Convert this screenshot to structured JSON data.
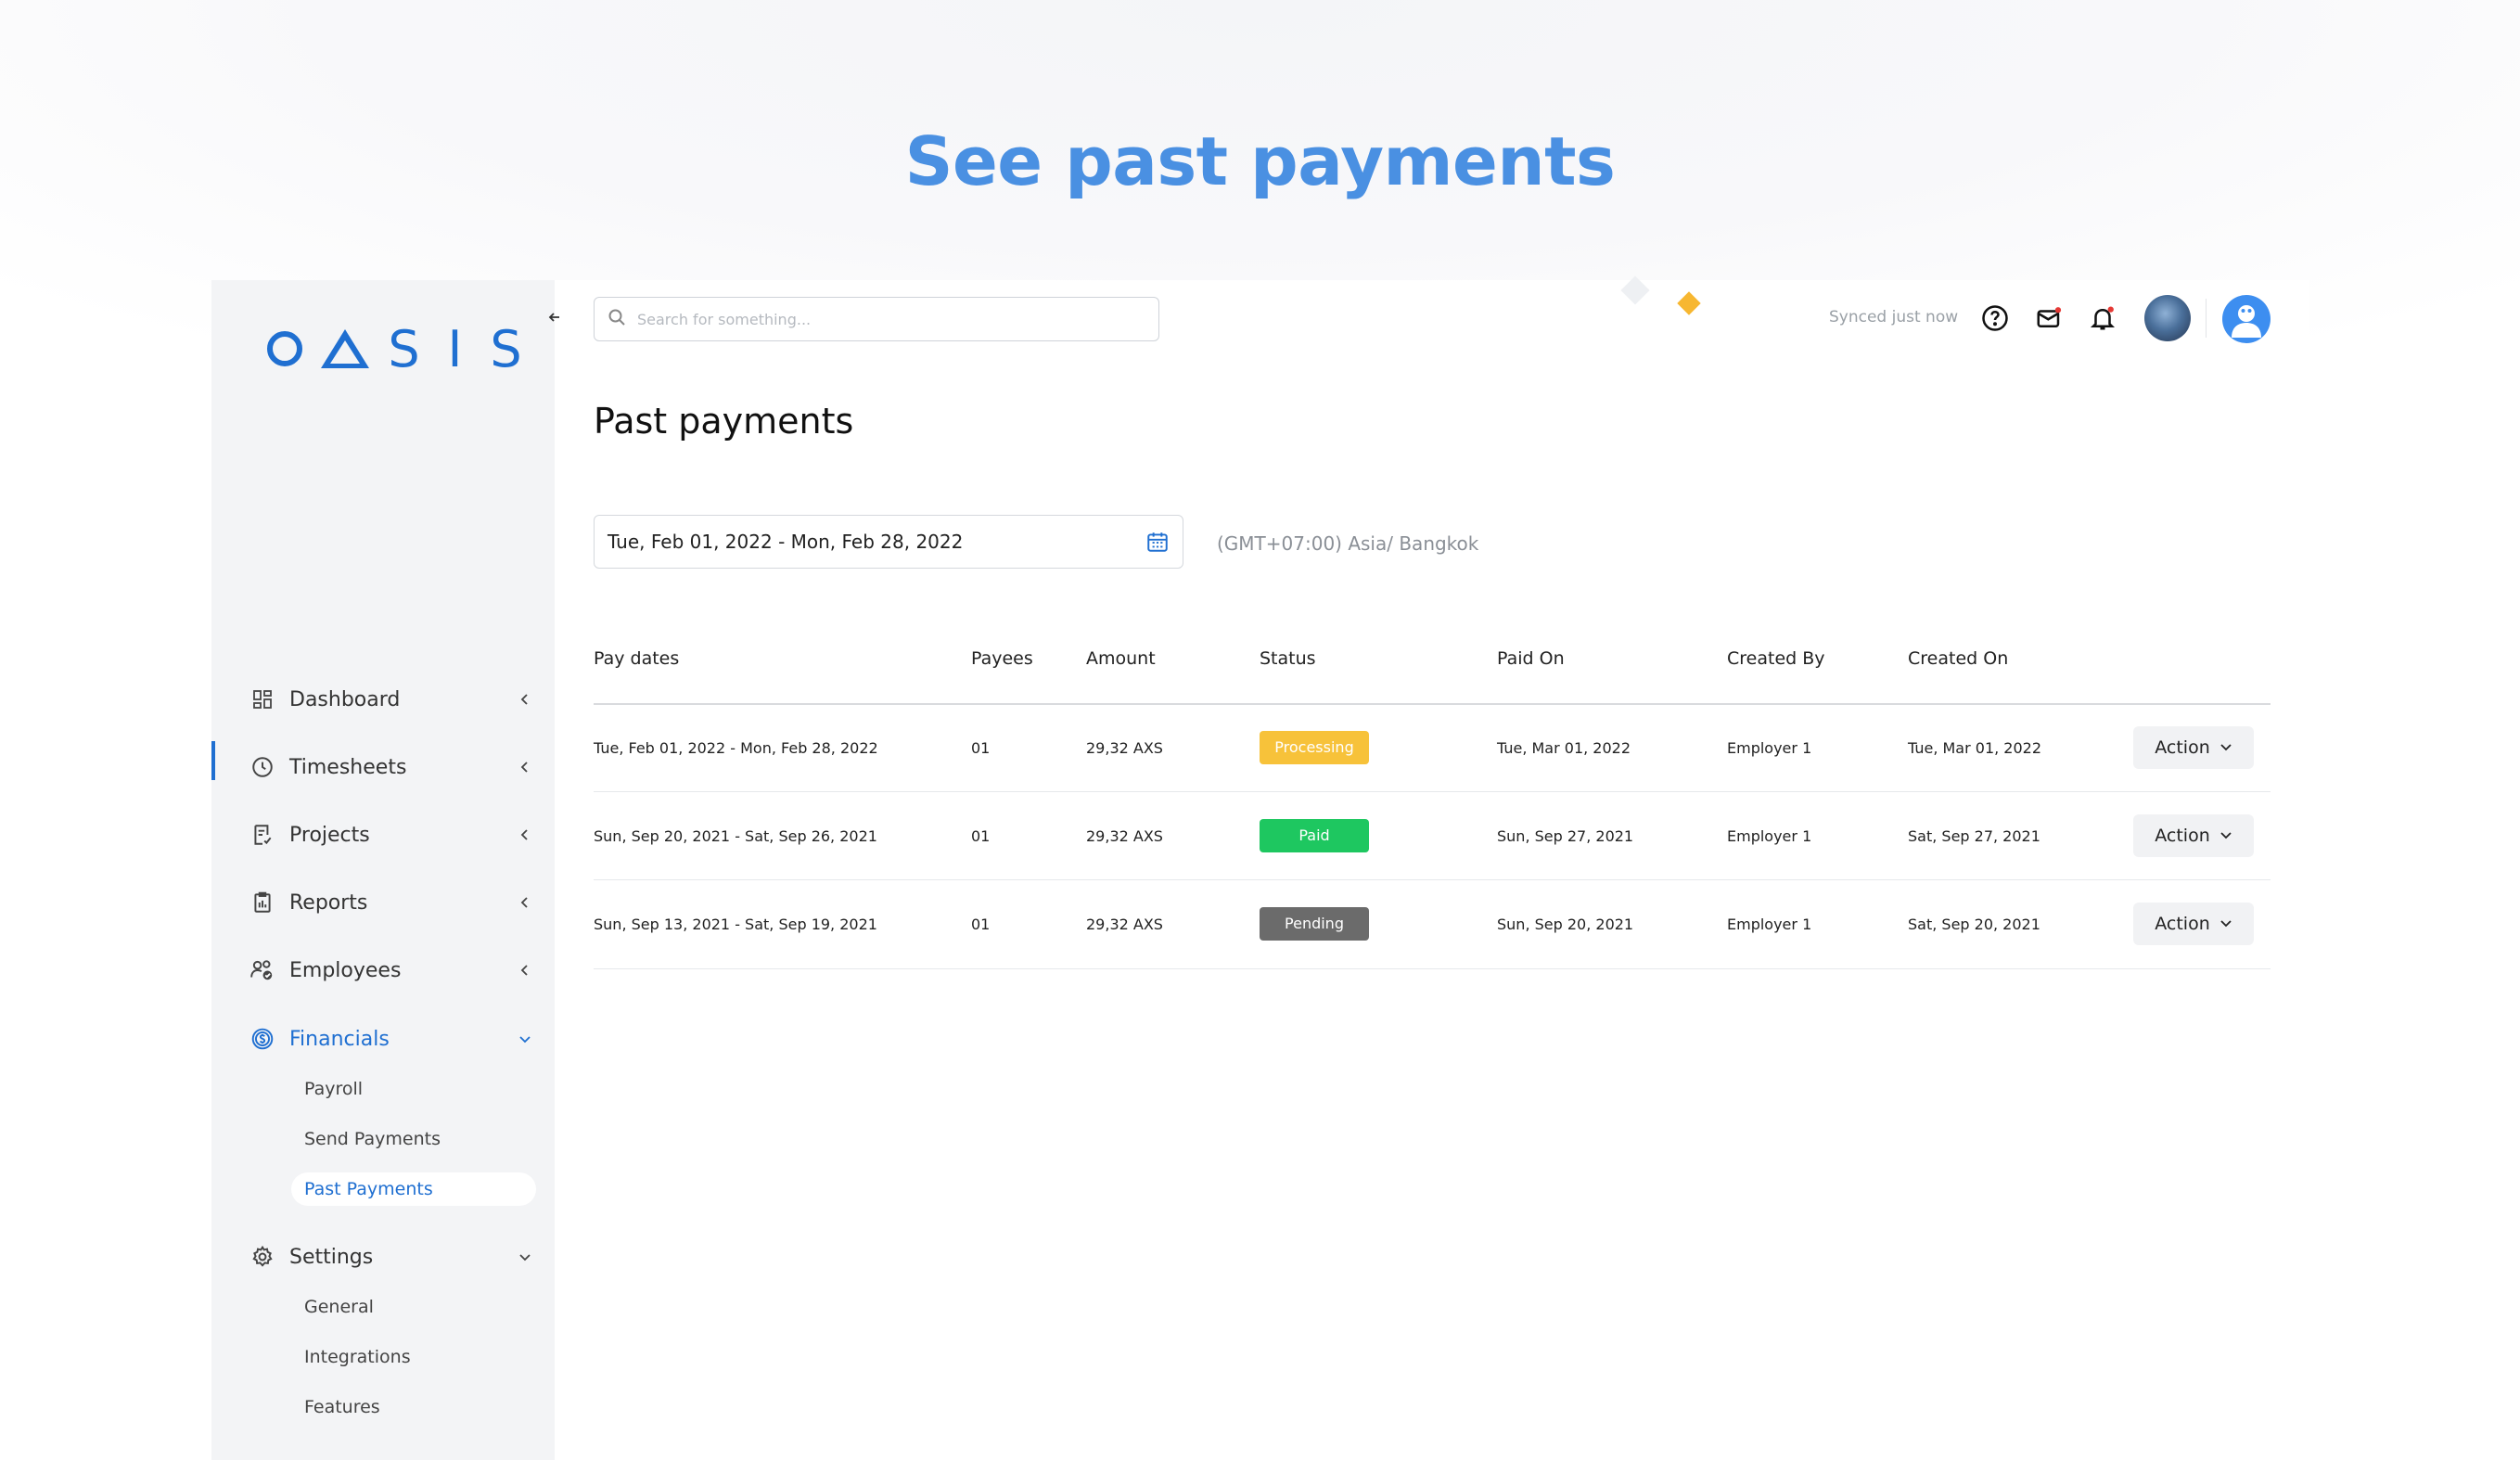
{
  "hero_title": "See past payments",
  "brand": {
    "logo_letters": [
      "S",
      "I",
      "S"
    ],
    "color": "#1f6fd1"
  },
  "sidebar": {
    "items": [
      {
        "label": "Dashboard",
        "icon": "dashboard-icon",
        "chevron": "chevron-left-icon"
      },
      {
        "label": "Timesheets",
        "icon": "clock-icon",
        "chevron": "chevron-left-icon"
      },
      {
        "label": "Projects",
        "icon": "projects-icon",
        "chevron": "chevron-left-icon"
      },
      {
        "label": "Reports",
        "icon": "clipboard-icon",
        "chevron": "chevron-left-icon"
      },
      {
        "label": "Employees",
        "icon": "employees-icon",
        "chevron": "chevron-left-icon"
      },
      {
        "label": "Financials",
        "icon": "dollar-icon",
        "chevron": "chevron-down-icon",
        "active": true,
        "children": [
          "Payroll",
          "Send Payments",
          "Past Payments"
        ],
        "active_child": "Past Payments"
      },
      {
        "label": "Settings",
        "icon": "gear-icon",
        "chevron": "chevron-down-icon",
        "children": [
          "General",
          "Integrations",
          "Features"
        ]
      }
    ]
  },
  "topbar": {
    "search_placeholder": "Search for something...",
    "sync_status": "Synced just now",
    "icons": [
      "help-icon",
      "mail-icon",
      "bell-icon"
    ]
  },
  "page": {
    "title": "Past payments",
    "date_range": "Tue, Feb 01, 2022 - Mon, Feb 28, 2022",
    "timezone": "(GMT+07:00) Asia/ Bangkok"
  },
  "table": {
    "columns": [
      "Pay dates",
      "Payees",
      "Amount",
      "Status",
      "Paid On",
      "Created By",
      "Created On"
    ],
    "action_label": "Action",
    "rows": [
      {
        "pay_dates": "Tue, Feb 01, 2022 - Mon, Feb 28, 2022",
        "payees": "01",
        "amount": "29,32 AXS",
        "status": "Processing",
        "status_color": "#f7c23a",
        "paid_on": "Tue, Mar 01, 2022",
        "created_by": "Employer 1",
        "created_on": "Tue, Mar 01, 2022"
      },
      {
        "pay_dates": "Sun, Sep 20, 2021 - Sat, Sep 26, 2021",
        "payees": "01",
        "amount": "29,32 AXS",
        "status": "Paid",
        "status_color": "#1ec760",
        "paid_on": "Sun, Sep 27, 2021",
        "created_by": "Employer 1",
        "created_on": "Sat, Sep 27, 2021"
      },
      {
        "pay_dates": "Sun, Sep 13, 2021 - Sat, Sep 19, 2021",
        "payees": "01",
        "amount": "29,32 AXS",
        "status": "Pending",
        "status_color": "#6b6b6b",
        "paid_on": "Sun, Sep 20, 2021",
        "created_by": "Employer 1",
        "created_on": "Sat, Sep 20, 2021"
      }
    ]
  }
}
